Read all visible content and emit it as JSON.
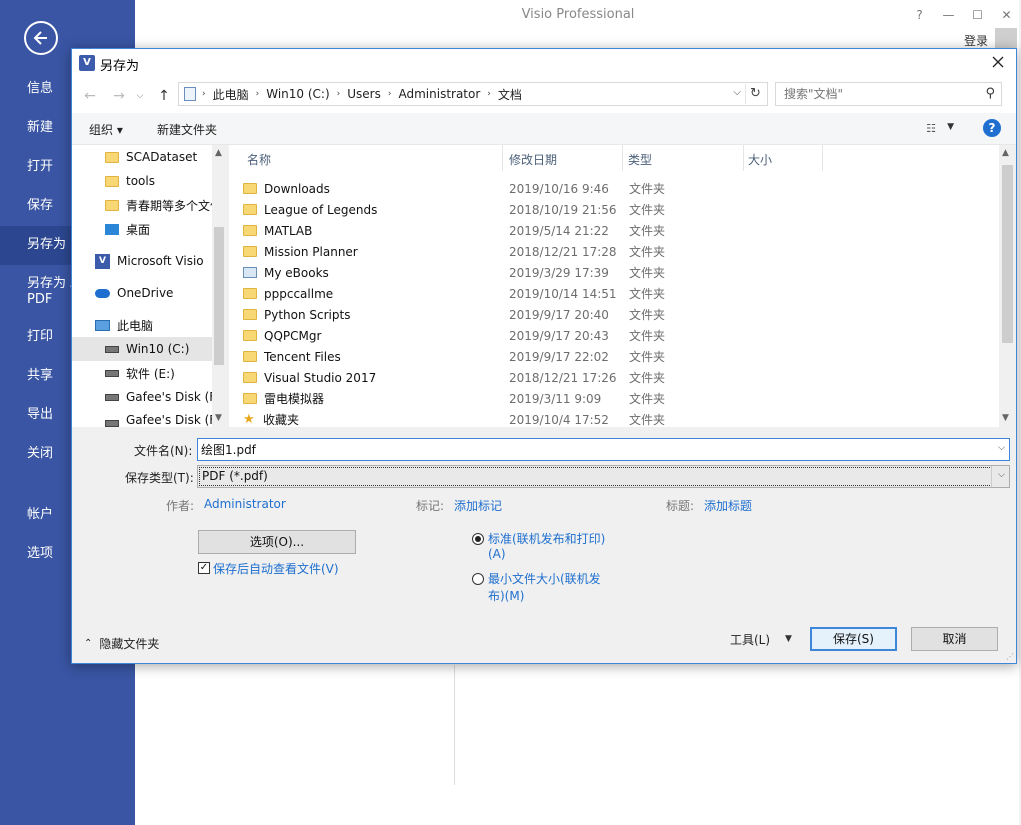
{
  "app": {
    "title": "Visio Professional",
    "help": "?",
    "minimize": "—",
    "restore": "☐",
    "close": "✕",
    "login": "登录"
  },
  "backstage": {
    "items": [
      {
        "label": "信息"
      },
      {
        "label": "新建"
      },
      {
        "label": "打开"
      },
      {
        "label": "保存"
      },
      {
        "label": "另存为"
      },
      {
        "label": "另存为 Adobe PDF",
        "line1": "另存为 A",
        "line2": "PDF"
      },
      {
        "label": "打印"
      },
      {
        "label": "共享"
      },
      {
        "label": "导出"
      },
      {
        "label": "关闭"
      },
      {
        "label": "帐户"
      },
      {
        "label": "选项"
      }
    ]
  },
  "dialog": {
    "title": "另存为",
    "icon_letter": "V",
    "breadcrumbs": [
      "此电脑",
      "Win10 (C:)",
      "Users",
      "Administrator",
      "文档"
    ],
    "search_placeholder": "搜索\"文档\"",
    "toolbar": {
      "organize": "组织 ▾",
      "new_folder": "新建文件夹"
    },
    "nav_items": [
      {
        "label": "SCADataset",
        "icon": "folder-icon"
      },
      {
        "label": "tools",
        "icon": "folder-icon"
      },
      {
        "label": "青春期等多个文件",
        "icon": "folder-icon"
      },
      {
        "label": "桌面",
        "icon": "desktop-icon"
      },
      {
        "label": "Microsoft Visio",
        "icon": "visio-icon"
      },
      {
        "label": "OneDrive",
        "icon": "cloud-icon"
      },
      {
        "label": "此电脑",
        "icon": "pc-icon"
      },
      {
        "label": "Win10 (C:)",
        "icon": "drive-icon"
      },
      {
        "label": "软件 (E:)",
        "icon": "drive-icon"
      },
      {
        "label": "Gafee's Disk (F",
        "icon": "drive-icon"
      },
      {
        "label": "Gafee's Disk (F",
        "icon": "drive-icon"
      }
    ],
    "columns": {
      "name": "名称",
      "modified": "修改日期",
      "type": "类型",
      "size": "大小"
    },
    "files": [
      {
        "name": "Downloads",
        "modified": "2019/10/16 9:46",
        "type": "文件夹",
        "icon": "folder-icon"
      },
      {
        "name": "League of Legends",
        "modified": "2018/10/19 21:56",
        "type": "文件夹",
        "icon": "folder-icon"
      },
      {
        "name": "MATLAB",
        "modified": "2019/5/14 21:22",
        "type": "文件夹",
        "icon": "folder-icon"
      },
      {
        "name": "Mission Planner",
        "modified": "2018/12/21 17:28",
        "type": "文件夹",
        "icon": "folder-icon"
      },
      {
        "name": "My eBooks",
        "modified": "2019/3/29 17:39",
        "type": "文件夹",
        "icon": "ebook-icon"
      },
      {
        "name": "pppccallme",
        "modified": "2019/10/14 14:51",
        "type": "文件夹",
        "icon": "folder-icon"
      },
      {
        "name": "Python Scripts",
        "modified": "2019/9/17 20:40",
        "type": "文件夹",
        "icon": "folder-icon"
      },
      {
        "name": "QQPCMgr",
        "modified": "2019/9/17 20:43",
        "type": "文件夹",
        "icon": "folder-icon"
      },
      {
        "name": "Tencent Files",
        "modified": "2019/9/17 22:02",
        "type": "文件夹",
        "icon": "folder-icon"
      },
      {
        "name": "Visual Studio 2017",
        "modified": "2018/12/21 17:26",
        "type": "文件夹",
        "icon": "folder-icon"
      },
      {
        "name": "雷电模拟器",
        "modified": "2019/3/11 9:09",
        "type": "文件夹",
        "icon": "folder-icon"
      },
      {
        "name": "收藏夹",
        "modified": "2019/10/4 17:52",
        "type": "文件夹",
        "icon": "star-icon"
      }
    ],
    "form": {
      "filename_label": "文件名(N):",
      "filename_value": "绘图1.pdf",
      "filetype_label": "保存类型(T):",
      "filetype_value": "PDF (*.pdf)",
      "author_label": "作者:",
      "author_value": "Administrator",
      "tags_label": "标记:",
      "tags_value": "添加标记",
      "title_label": "标题:",
      "title_value": "添加标题",
      "options_button": "选项(O)...",
      "open_after_save": "保存后自动查看文件(V)",
      "open_after_save_checked": true,
      "radio_standard_line1": "标准(联机发布和打印)",
      "radio_standard_line2": "(A)",
      "radio_min_line1": "最小文件大小(联机发",
      "radio_min_line2": "布)(M)"
    },
    "footer": {
      "hide_folders": "隐藏文件夹",
      "tools": "工具(L)",
      "save": "保存(S)",
      "cancel": "取消"
    }
  }
}
